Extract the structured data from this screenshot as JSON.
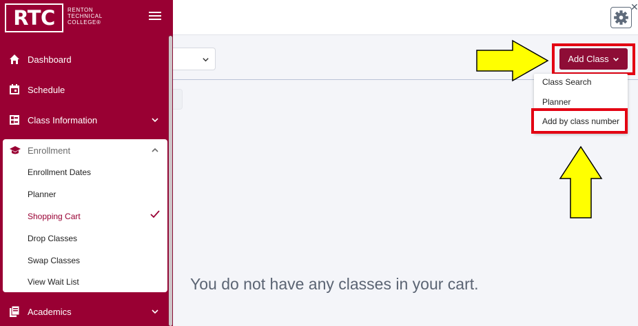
{
  "sidebar": {
    "logo": {
      "mark": "RTC",
      "line1": "RENTON",
      "line2": "TECHNICAL",
      "line3": "COLLEGE®"
    },
    "items": [
      {
        "label": "Dashboard",
        "icon": "home-icon"
      },
      {
        "label": "Schedule",
        "icon": "calendar-icon"
      },
      {
        "label": "Class Information",
        "icon": "list-icon"
      },
      {
        "label": "Academics",
        "icon": "document-icon"
      }
    ],
    "enrollment": {
      "label": "Enrollment",
      "icon": "graduation-cap-icon",
      "sub_items": [
        {
          "label": "Enrollment Dates"
        },
        {
          "label": "Planner"
        },
        {
          "label": "Shopping Cart",
          "active": true
        },
        {
          "label": "Drop Classes"
        },
        {
          "label": "Swap Classes"
        },
        {
          "label": "View Wait List"
        }
      ]
    }
  },
  "header": {
    "add_class_label": "Add Class",
    "menu": [
      {
        "label": "Class Search"
      },
      {
        "label": "Planner"
      },
      {
        "label": "Add by class number"
      }
    ]
  },
  "main": {
    "empty_message": "You do not have any classes in your cart."
  },
  "colors": {
    "brand": "#990033",
    "button": "#8e0d36",
    "highlight": "#e30012",
    "arrow_fill": "#ffff00"
  }
}
